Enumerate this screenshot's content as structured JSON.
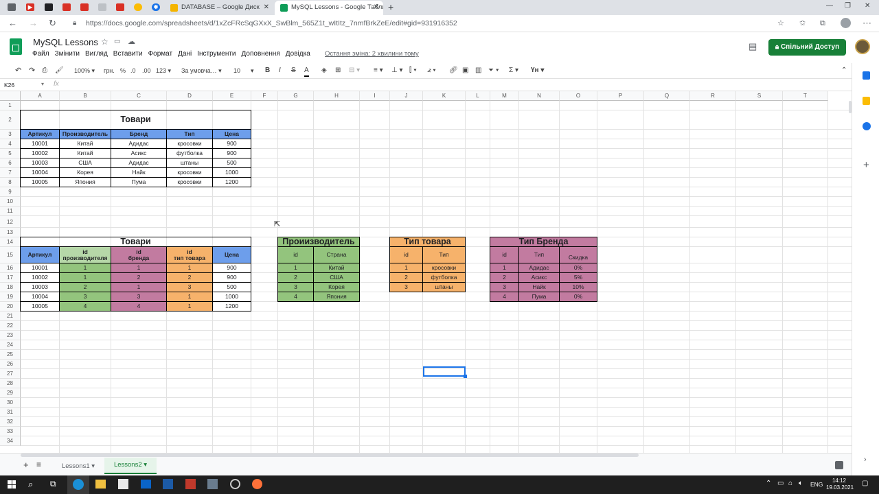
{
  "browser": {
    "tabs": [
      {
        "label": "DATABASE – Google Диск",
        "color": "#f4b400"
      },
      {
        "label": "MySQL Lessons - Google Табли…",
        "color": "#0f9d58",
        "active": true
      }
    ],
    "url": "https://docs.google.com/spreadsheets/d/1xZcFRcSqGXxX_SwBlm_565Z1t_wItItz_7nmfBrkZeE/edit#gid=931916352"
  },
  "doc": {
    "title": "MySQL Lessons",
    "menu": [
      "Файл",
      "Змінити",
      "Вигляд",
      "Вставити",
      "Формат",
      "Дані",
      "Інструменти",
      "Доповнення",
      "Довідка"
    ],
    "last_edit": "Остання зміна: 2 хвилини тому",
    "share": "Спільний Доступ"
  },
  "toolbar": {
    "zoom": "100%",
    "currency": "грн.",
    "percent": "%",
    "dec_less": ".0",
    "dec_more": ".00",
    "format_num": "123",
    "font": "За умовча…",
    "font_size": "10",
    "bold": "B",
    "italic": "I",
    "strike": "S",
    "text_color": "A",
    "sigma": "Σ"
  },
  "formula_bar": {
    "cell_ref": "K26",
    "fx": "fx"
  },
  "columns": [
    "A",
    "B",
    "C",
    "D",
    "E",
    "F",
    "G",
    "H",
    "I",
    "J",
    "K",
    "L",
    "M",
    "N",
    "O",
    "P",
    "Q",
    "R",
    "S",
    "T"
  ],
  "rows": [
    "1",
    "2",
    "3",
    "4",
    "5",
    "6",
    "7",
    "8",
    "9",
    "10",
    "11",
    "12",
    "13",
    "14",
    "15",
    "16",
    "17",
    "18",
    "19",
    "20",
    "21",
    "22",
    "23",
    "24",
    "25",
    "26",
    "27",
    "28",
    "29",
    "30",
    "31",
    "32",
    "33",
    "34"
  ],
  "table1": {
    "title": "Товари",
    "headers": [
      "Артикул",
      "Производитель",
      "Бренд",
      "Тип",
      "Цена"
    ],
    "rows": [
      [
        "10001",
        "Китай",
        "Адидас",
        "кросовки",
        "900"
      ],
      [
        "10002",
        "Китай",
        "Асикс",
        "футболка",
        "900"
      ],
      [
        "10003",
        "США",
        "Адидас",
        "штаны",
        "500"
      ],
      [
        "10004",
        "Корея",
        "Найк",
        "кросовки",
        "1000"
      ],
      [
        "10005",
        "Япония",
        "Пума",
        "кросовки",
        "1200"
      ]
    ]
  },
  "table2": {
    "title": "Товари",
    "h_art": "Артикул",
    "h_prod1": "id",
    "h_prod2": "производителя",
    "h_brand1": "id",
    "h_brand2": "бренда",
    "h_type1": "id",
    "h_type2": "тип товара",
    "h_price": "Цена",
    "rows": [
      [
        "10001",
        "1",
        "1",
        "1",
        "900"
      ],
      [
        "10002",
        "1",
        "2",
        "2",
        "900"
      ],
      [
        "10003",
        "2",
        "1",
        "3",
        "500"
      ],
      [
        "10004",
        "3",
        "3",
        "1",
        "1000"
      ],
      [
        "10005",
        "4",
        "4",
        "1",
        "1200"
      ]
    ]
  },
  "table3": {
    "title": "Проиизводитель",
    "headers": [
      "id",
      "Страна"
    ],
    "rows": [
      [
        "1",
        "Китай"
      ],
      [
        "2",
        "США"
      ],
      [
        "3",
        "Корея"
      ],
      [
        "4",
        "Япония"
      ]
    ]
  },
  "table4": {
    "title": "Тип товара",
    "headers": [
      "id",
      "Тип"
    ],
    "rows": [
      [
        "1",
        "кросовки"
      ],
      [
        "2",
        "футболка"
      ],
      [
        "3",
        "штаны"
      ]
    ]
  },
  "table5": {
    "title": "Тип Бренда",
    "headers": [
      "id",
      "Тип",
      "Скидка"
    ],
    "rows": [
      [
        "1",
        "Адидас",
        "0%"
      ],
      [
        "2",
        "Асикс",
        "5%"
      ],
      [
        "3",
        "Найк",
        "10%"
      ],
      [
        "4",
        "Пума",
        "0%"
      ]
    ]
  },
  "sheets": [
    {
      "label": "Lessons1"
    },
    {
      "label": "Lessons2",
      "active": true
    }
  ],
  "taskbar": {
    "lang": "ENG",
    "time": "14:12",
    "date": "19.03.2021"
  },
  "colors": {
    "blue": "#6d9eeb",
    "green": "#93c47d",
    "lightgreen": "#b6d7a8",
    "pink": "#c27ba0",
    "orange": "#f6b26b",
    "accent": "#188038"
  }
}
